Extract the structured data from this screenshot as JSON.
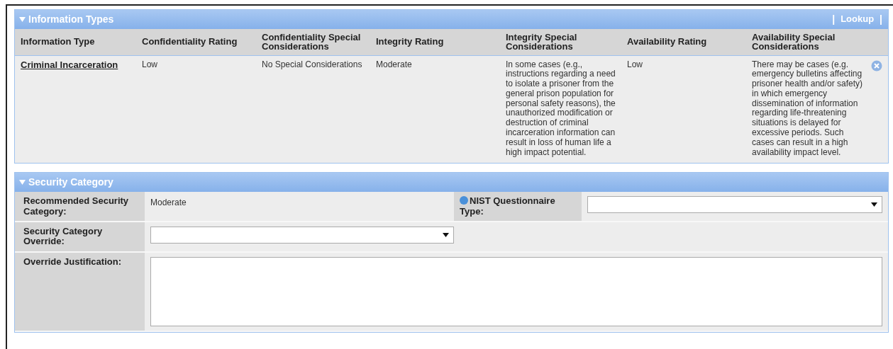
{
  "info_types": {
    "title": "Information Types",
    "expanded": true,
    "lookup_link": "Lookup",
    "separator_left": "|",
    "separator_right": "|",
    "columns": [
      "Information Type",
      "Confidentiality Rating",
      "Confidentiality Special Considerations",
      "Integrity Rating",
      "Integrity Special Considerations",
      "Availability Rating",
      "Availability Special Considerations"
    ],
    "rows": [
      {
        "cells": [
          "Criminal Incarceration",
          "Low",
          "No Special Considerations",
          "Moderate",
          "In some cases (e.g., instructions regarding a need to isolate a prisoner from the general prison population for personal safety reasons), the unauthorized modification or destruction of criminal incarceration information can result in loss of human life a high impact potential.",
          "Low",
          "There may be cases (e.g. emergency bulletins affecting prisoner health and/or safety) in which emergency dissemination of information regarding life-threatening situations is delayed for excessive periods. Such cases can result in a high availability impact level."
        ]
      }
    ]
  },
  "security_category": {
    "title": "Security Category",
    "expanded": true,
    "recommended_label": "Recommended Security Category:",
    "recommended_value": "Moderate",
    "nist_label": "NIST Questionnaire Type:",
    "override_label": "Security Category Override:",
    "justification_label": "Override Justification:"
  }
}
